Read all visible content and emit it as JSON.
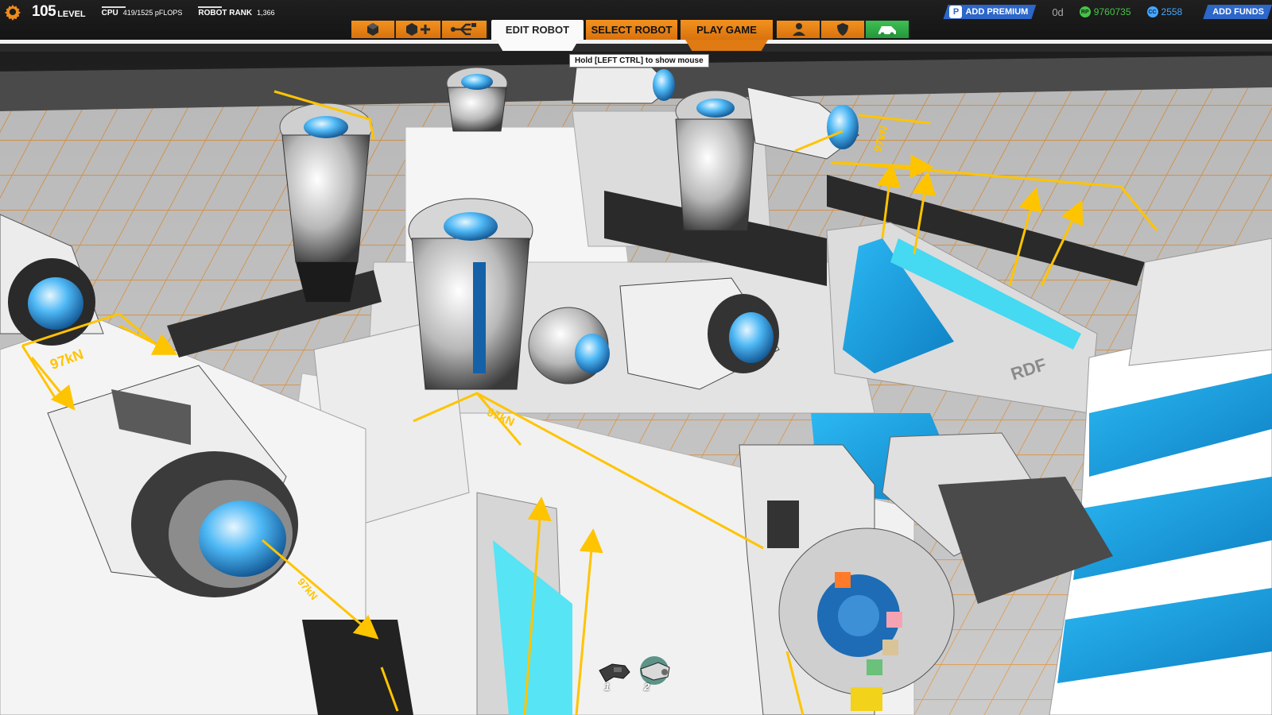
{
  "hud": {
    "level_value": "105",
    "level_label": "LEVEL",
    "cpu_label": "CPU",
    "cpu_value": "419/1525 pFLOPS",
    "rank_label": "ROBOT RANK",
    "rank_value": "1,366",
    "settings_icon": "gear-icon"
  },
  "toolbar": {
    "left_buttons": [
      {
        "name": "cube-inventory",
        "icon": "cube-icon"
      },
      {
        "name": "cube-add",
        "icon": "cube-add-icon"
      },
      {
        "name": "connection",
        "icon": "usb-connection-icon"
      }
    ],
    "tabs": [
      {
        "name": "edit-robot",
        "label": "EDIT ROBOT",
        "active": true
      },
      {
        "name": "select-robot",
        "label": "SELECT ROBOT",
        "active": false
      },
      {
        "name": "play-game",
        "label": "PLAY GAME",
        "active": false
      }
    ],
    "right_buttons": [
      {
        "name": "profile",
        "icon": "person-icon"
      },
      {
        "name": "clan",
        "icon": "shield-icon"
      },
      {
        "name": "garage",
        "icon": "garage-robot-icon"
      }
    ]
  },
  "account": {
    "add_premium_label": "ADD PREMIUM",
    "premium_days": "0d",
    "robits_value": "9760735",
    "robits_icon_text": "RP",
    "cosmetic_value": "2558",
    "cosmetic_icon_text": "CC",
    "add_funds_label": "ADD FUNDS"
  },
  "tooltip": "Hold [LEFT CTRL] to show mouse",
  "scene": {
    "thrust_labels": [
      "97kN",
      "97kN",
      "97kN",
      "97kN"
    ],
    "stamp_text": "RDF"
  },
  "hotbar": {
    "slots": [
      {
        "number": "1",
        "icon": "smg-weapon-icon"
      },
      {
        "number": "2",
        "icon": "plasma-weapon-icon"
      }
    ]
  },
  "colors": {
    "accent_orange": "#F0891A",
    "premium_blue": "#2C67C9",
    "robits_green": "#48C24A",
    "cosmetic_blue": "#46A6FF",
    "force_arrow_yellow": "#FFC400",
    "hull_blue": "#22A7E8"
  }
}
